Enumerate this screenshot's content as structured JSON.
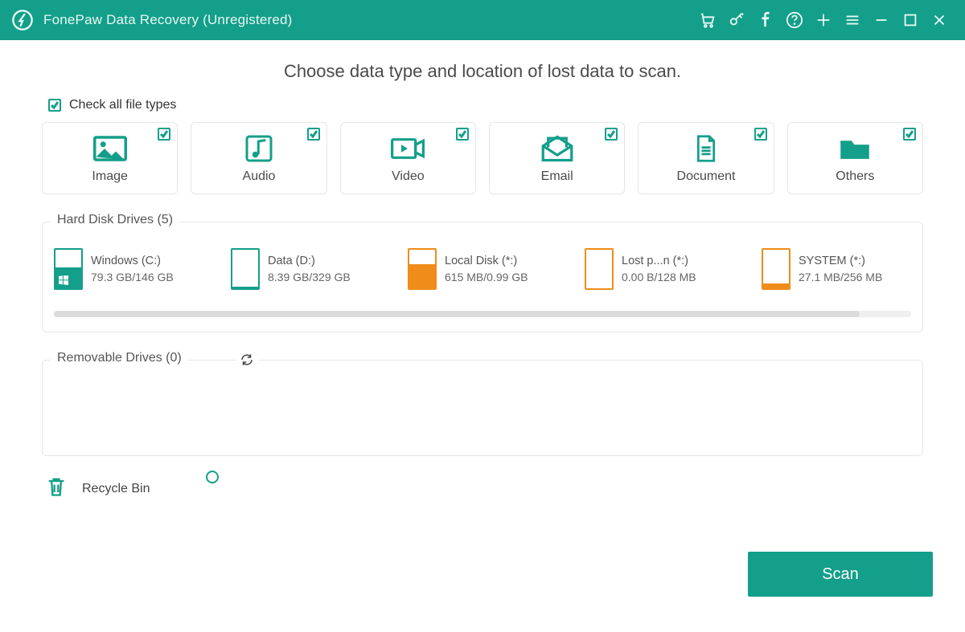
{
  "window": {
    "title": "FonePaw Data Recovery (Unregistered)"
  },
  "heading": "Choose data type and location of lost data to scan.",
  "checkAll": {
    "label": "Check all file types",
    "checked": true
  },
  "fileTypes": [
    {
      "id": "image",
      "label": "Image",
      "checked": true
    },
    {
      "id": "audio",
      "label": "Audio",
      "checked": true
    },
    {
      "id": "video",
      "label": "Video",
      "checked": true
    },
    {
      "id": "email",
      "label": "Email",
      "checked": true
    },
    {
      "id": "document",
      "label": "Document",
      "checked": true
    },
    {
      "id": "others",
      "label": "Others",
      "checked": true
    }
  ],
  "hardDisk": {
    "legend": "Hard Disk Drives (5)",
    "drives": [
      {
        "name": "Windows (C:)",
        "capacity": "79.3 GB/146 GB",
        "fillPct": 55,
        "color": "#139f8a",
        "selected": true,
        "isSystem": true
      },
      {
        "name": "Data (D:)",
        "capacity": "8.39 GB/329 GB",
        "fillPct": 4,
        "color": "#139f8a",
        "selected": false,
        "isSystem": false
      },
      {
        "name": "Local Disk (*:)",
        "capacity": "615 MB/0.99 GB",
        "fillPct": 62,
        "color": "#f08c1a",
        "selected": false,
        "isSystem": false
      },
      {
        "name": "Lost p...n (*:)",
        "capacity": "0.00  B/128 MB",
        "fillPct": 0,
        "color": "#f08c1a",
        "selected": false,
        "isSystem": false
      },
      {
        "name": "SYSTEM (*:)",
        "capacity": "27.1 MB/256 MB",
        "fillPct": 12,
        "color": "#f08c1a",
        "selected": false,
        "isSystem": false
      }
    ]
  },
  "removable": {
    "legend": "Removable Drives (0)"
  },
  "recycle": {
    "label": "Recycle Bin",
    "selected": false
  },
  "scanButton": "Scan"
}
